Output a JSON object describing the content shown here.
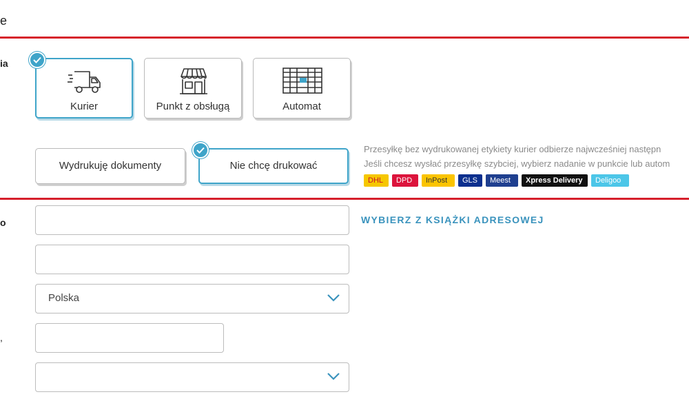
{
  "header": {
    "title_fragment": "e"
  },
  "section_label_fragments": {
    "delivery": "ia",
    "recipient": "o",
    "row4": ","
  },
  "delivery_methods": [
    {
      "label": "Kurier",
      "icon": "truck-icon",
      "selected": true
    },
    {
      "label": "Punkt z obsługą",
      "icon": "storefront-icon",
      "selected": false
    },
    {
      "label": "Automat",
      "icon": "parcel-locker-icon",
      "selected": false
    }
  ],
  "print_options": [
    {
      "label": "Wydrukuję dokumenty",
      "selected": false
    },
    {
      "label": "Nie chcę drukować",
      "selected": true
    }
  ],
  "info": {
    "line1": "Przesyłkę bez wydrukowanej etykiety kurier odbierze najwcześniej następn",
    "line2": "Jeśli chcesz wysłać przesyłkę szybciej, wybierz nadanie w punkcie lub autom"
  },
  "carriers": [
    {
      "name": "DHL",
      "bg": "#f6c700",
      "fg": "#c8102e"
    },
    {
      "name": "DPD",
      "bg": "#dc143c",
      "fg": "#ffffff"
    },
    {
      "name": "InPost",
      "bg": "#fbc400",
      "fg": "#333333"
    },
    {
      "name": "GLS",
      "bg": "#0b2f8e",
      "fg": "#ffffff"
    },
    {
      "name": "Meest",
      "bg": "#1f3f8f",
      "fg": "#ffffff"
    },
    {
      "name": "Xpress Delivery",
      "bg": "#111111",
      "fg": "#ffffff"
    },
    {
      "name": "Deligoo",
      "bg": "#4cc6e8",
      "fg": "#ffffff"
    }
  ],
  "form": {
    "address_book_link": "WYBIERZ Z KSIĄŻKI ADRESOWEJ",
    "country_value": "Polska",
    "field1_value": "",
    "field2_value": "",
    "field4_value": "",
    "select2_value": ""
  },
  "colors": {
    "accent": "#3ea4c9",
    "highlight": "#d61f2b",
    "link": "#3a93bd"
  }
}
